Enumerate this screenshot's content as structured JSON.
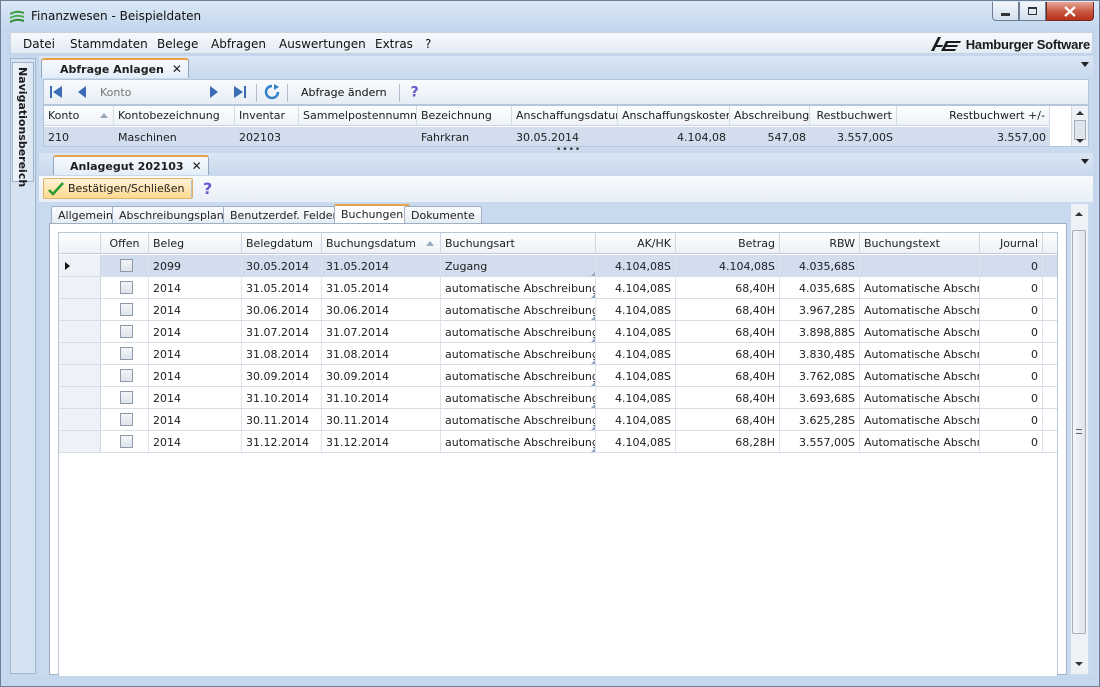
{
  "window": {
    "title": "Finanzwesen - Beispieldaten",
    "brand": "Hamburger Software"
  },
  "menu": [
    "Datei",
    "Stammdaten",
    "Belege",
    "Abfragen",
    "Auswertungen",
    "Extras",
    "?"
  ],
  "sidebar": {
    "label": "Navigationsbereich"
  },
  "query_tab": {
    "label": "Abfrage Anlagen",
    "close": "✕"
  },
  "toolbar1": {
    "konto_placeholder": "Konto",
    "change_query_label": "Abfrage ändern"
  },
  "grid1": {
    "columns": [
      "Konto",
      "Kontobezeichnung",
      "Inventar",
      "Sammelpostennummer",
      "Bezeichnung",
      "Anschaffungsdatum",
      "Anschaffungskosten",
      "Abschreibung",
      "Restbuchwert",
      "Restbuchwert +/-"
    ],
    "row": [
      "210",
      "Maschinen",
      "202103",
      "",
      "Fahrkran",
      "30.05.2014",
      "4.104,08",
      "547,08",
      "3.557,00S",
      "3.557,00"
    ]
  },
  "splitter": "••••",
  "asset_tab": {
    "label": "Anlagegut 202103",
    "close": "✕"
  },
  "toolbar2": {
    "confirm_label": "Bestätigen/Schließen"
  },
  "subtabs": [
    "Allgemein",
    "Abschreibungsplan",
    "Benutzerdef. Felder",
    "Buchungen",
    "Dokumente"
  ],
  "active_subtab": "Buchungen",
  "grid2": {
    "columns": [
      "",
      "Offen",
      "Beleg",
      "Belegdatum",
      "Buchungsdatum",
      "Buchungsart",
      "AK/HK",
      "Betrag",
      "RBW",
      "Buchungstext",
      "Journal"
    ],
    "rows": [
      {
        "beleg": "2099",
        "belegdatum": "30.05.2014",
        "buchungsdatum": "31.05.2014",
        "buchungsart": "Zugang",
        "akhk": "4.104,08S",
        "betrag": "4.104,08S",
        "rbw": "4.035,68S",
        "text": "",
        "journal": "0"
      },
      {
        "beleg": "2014",
        "belegdatum": "31.05.2014",
        "buchungsdatum": "31.05.2014",
        "buchungsart": "automatische Abschreibung",
        "akhk": "4.104,08S",
        "betrag": "68,40H",
        "rbw": "4.035,68S",
        "text": "Automatische Abschr...",
        "journal": "0"
      },
      {
        "beleg": "2014",
        "belegdatum": "30.06.2014",
        "buchungsdatum": "30.06.2014",
        "buchungsart": "automatische Abschreibung",
        "akhk": "4.104,08S",
        "betrag": "68,40H",
        "rbw": "3.967,28S",
        "text": "Automatische Abschr...",
        "journal": "0"
      },
      {
        "beleg": "2014",
        "belegdatum": "31.07.2014",
        "buchungsdatum": "31.07.2014",
        "buchungsart": "automatische Abschreibung",
        "akhk": "4.104,08S",
        "betrag": "68,40H",
        "rbw": "3.898,88S",
        "text": "Automatische Abschr...",
        "journal": "0"
      },
      {
        "beleg": "2014",
        "belegdatum": "31.08.2014",
        "buchungsdatum": "31.08.2014",
        "buchungsart": "automatische Abschreibung",
        "akhk": "4.104,08S",
        "betrag": "68,40H",
        "rbw": "3.830,48S",
        "text": "Automatische Abschr...",
        "journal": "0"
      },
      {
        "beleg": "2014",
        "belegdatum": "30.09.2014",
        "buchungsdatum": "30.09.2014",
        "buchungsart": "automatische Abschreibung",
        "akhk": "4.104,08S",
        "betrag": "68,40H",
        "rbw": "3.762,08S",
        "text": "Automatische Abschr...",
        "journal": "0"
      },
      {
        "beleg": "2014",
        "belegdatum": "31.10.2014",
        "buchungsdatum": "31.10.2014",
        "buchungsart": "automatische Abschreibung",
        "akhk": "4.104,08S",
        "betrag": "68,40H",
        "rbw": "3.693,68S",
        "text": "Automatische Abschr...",
        "journal": "0"
      },
      {
        "beleg": "2014",
        "belegdatum": "30.11.2014",
        "buchungsdatum": "30.11.2014",
        "buchungsart": "automatische Abschreibung",
        "akhk": "4.104,08S",
        "betrag": "68,40H",
        "rbw": "3.625,28S",
        "text": "Automatische Abschr...",
        "journal": "0"
      },
      {
        "beleg": "2014",
        "belegdatum": "31.12.2014",
        "buchungsdatum": "31.12.2014",
        "buchungsart": "automatische Abschreibung",
        "akhk": "4.104,08S",
        "betrag": "68,28H",
        "rbw": "3.557,00S",
        "text": "Automatische Abschr...",
        "journal": "0"
      }
    ]
  },
  "colors": {
    "accent_tab": "#e8a34a",
    "selected_row": "#d2ddee",
    "nav_blue": "#3a6bb5",
    "confirm_check": "#2f9a2f"
  }
}
